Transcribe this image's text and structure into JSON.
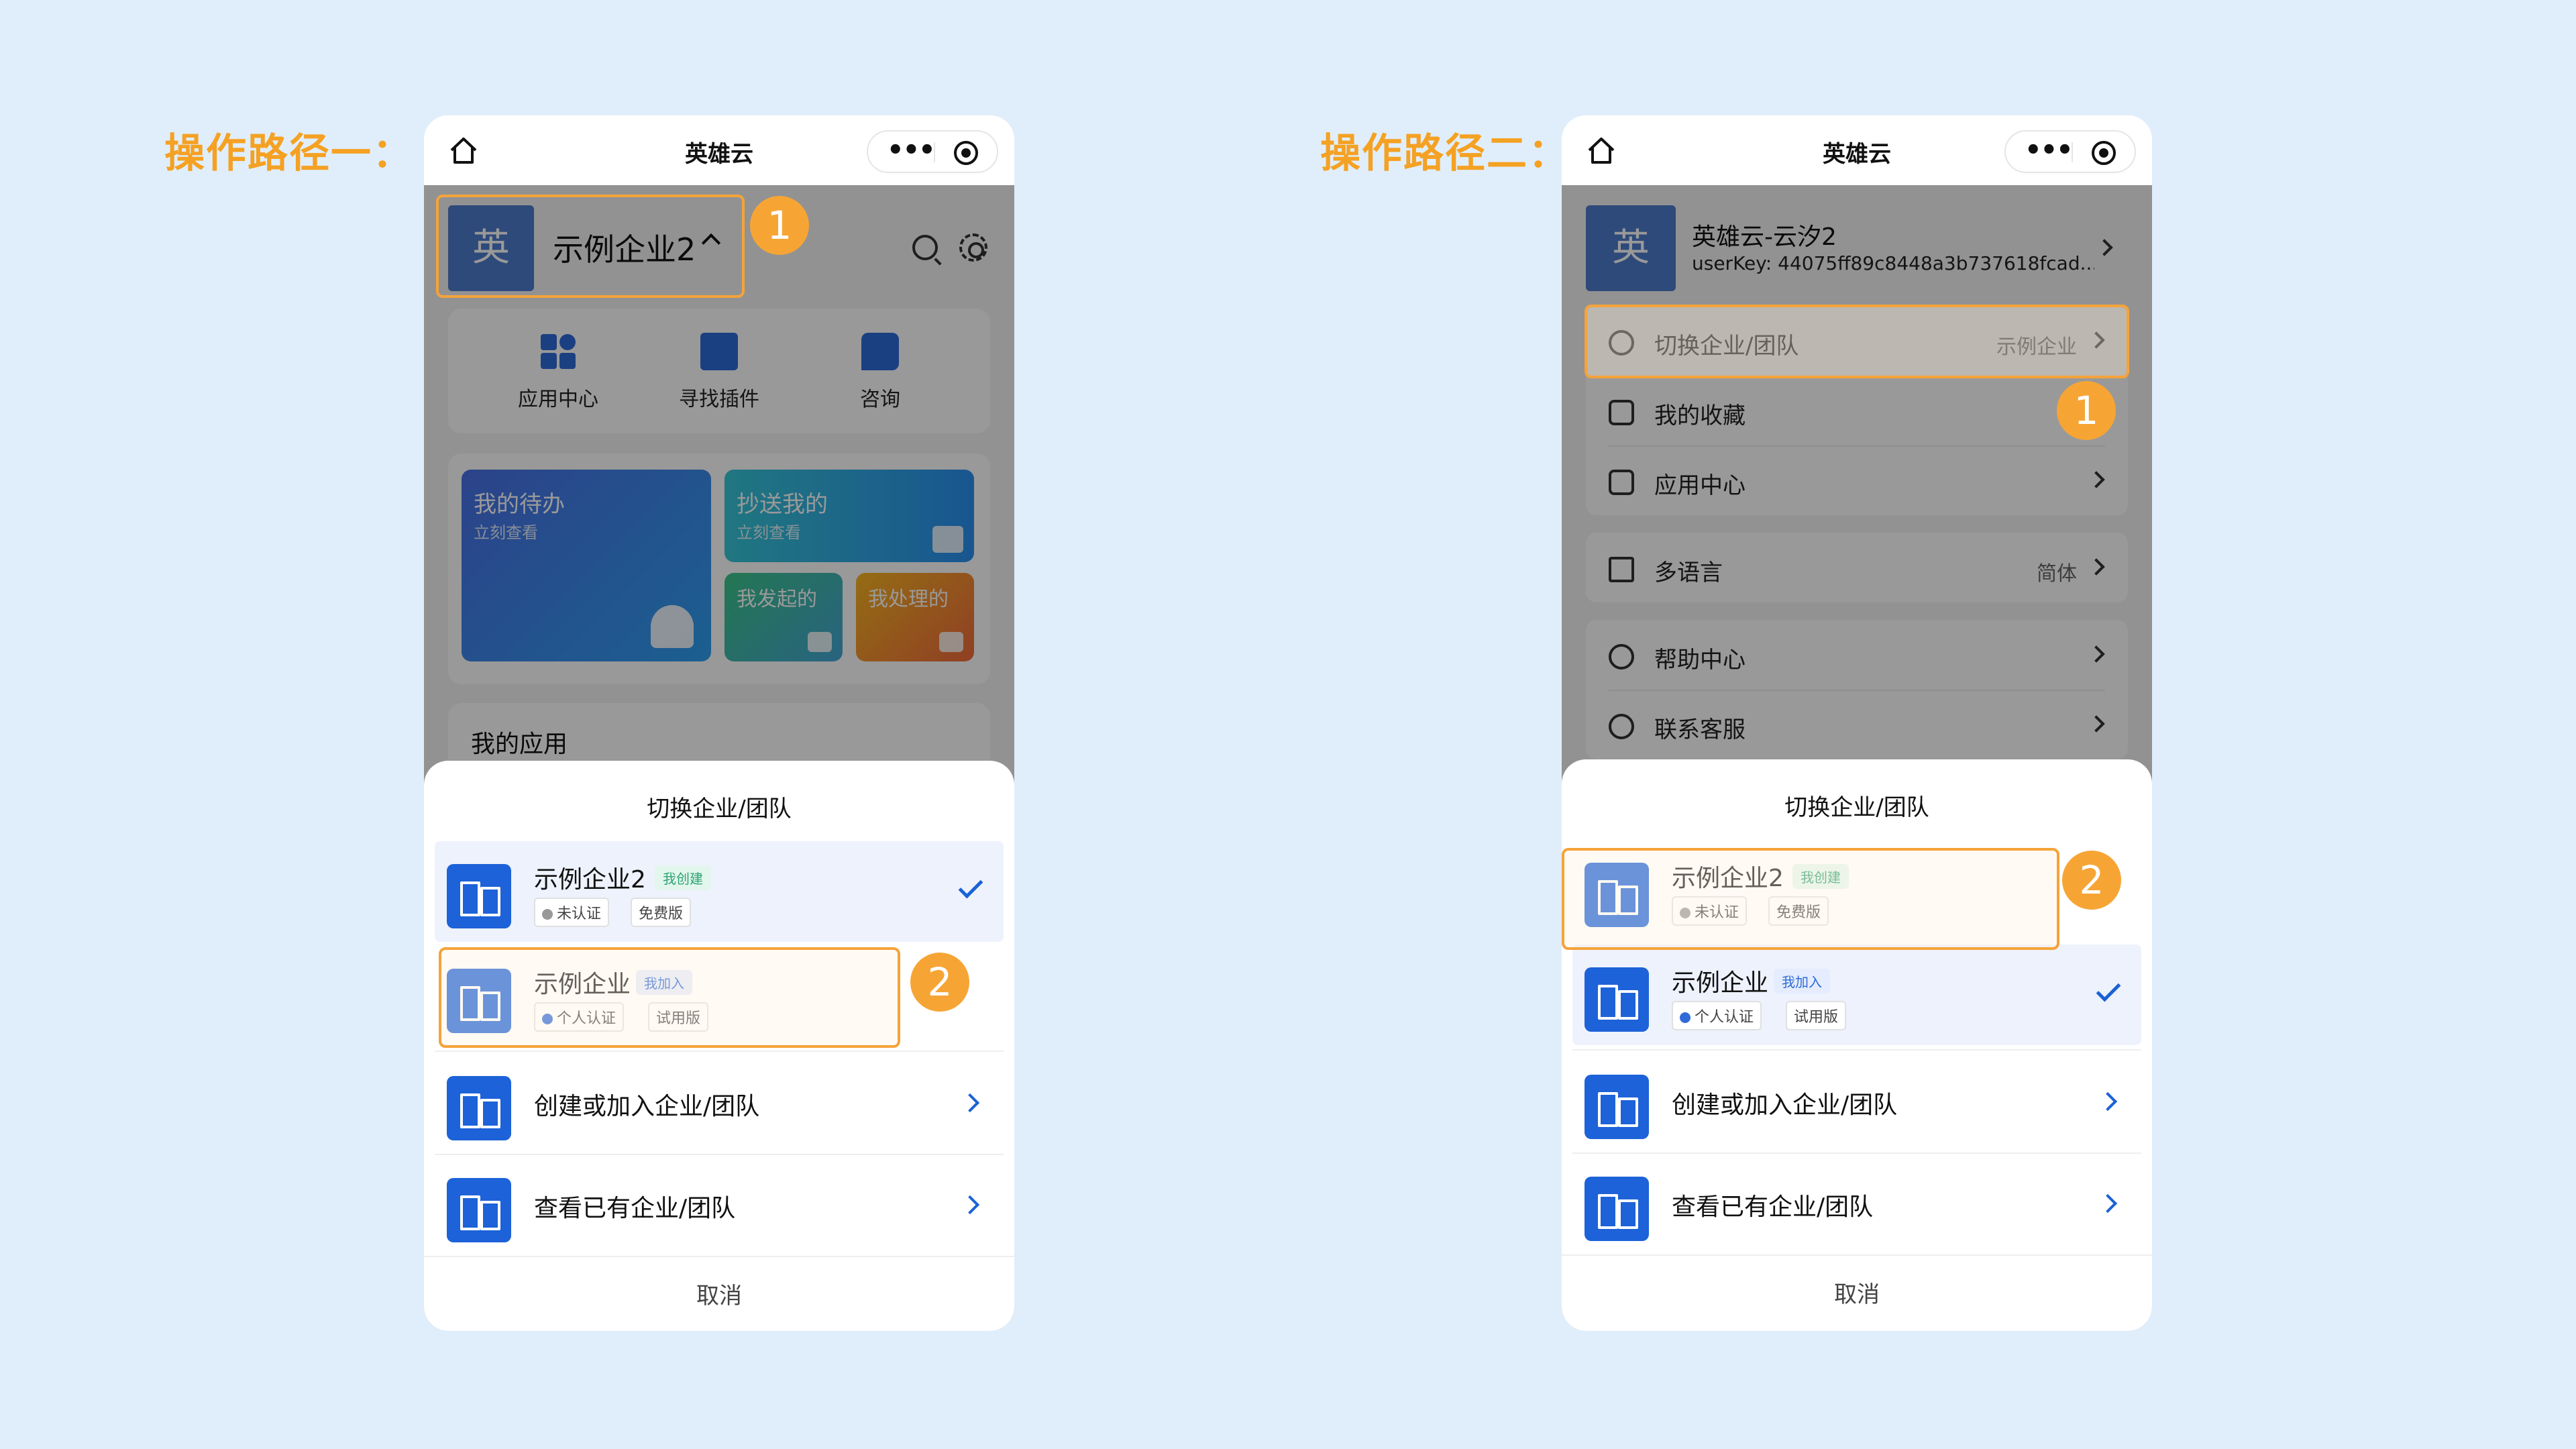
{
  "path1_title": "操作路径一：",
  "path2_title": "操作路径二：",
  "app_title": "英雄云",
  "avatar_char": "英",
  "nav": {
    "more_icon": "more-dots-icon",
    "target_icon": "target-icon",
    "home_icon": "home-icon"
  },
  "phone1": {
    "org_name": "示例企业2",
    "quick": [
      {
        "label": "应用中心",
        "icon": "app-grid-icon"
      },
      {
        "label": "寻找插件",
        "icon": "plugin-box-icon"
      },
      {
        "label": "咨询",
        "icon": "consult-chat-icon"
      }
    ],
    "tiles": {
      "todo": {
        "title": "我的待办",
        "sub": "立刻查看"
      },
      "cc": {
        "title": "抄送我的",
        "sub": "立刻查看"
      },
      "initiated": {
        "title": "我发起的"
      },
      "handled": {
        "title": "我处理的"
      }
    },
    "my_apps": "我的应用"
  },
  "phone2": {
    "user_name": "英雄云-云汐2",
    "user_key": "userKey: 44075ff89c8448a3b737618fcad...",
    "menu": [
      {
        "label": "切换企业/团队",
        "value": "示例企业",
        "icon": "switch-user-icon"
      },
      {
        "label": "我的收藏",
        "value": "",
        "icon": "star-icon"
      },
      {
        "label": "应用中心",
        "value": "",
        "icon": "app-center-icon"
      },
      {
        "label": "多语言",
        "value": "简体",
        "icon": "language-icon"
      },
      {
        "label": "帮助中心",
        "value": "",
        "icon": "help-icon"
      },
      {
        "label": "联系客服",
        "value": "",
        "icon": "headset-icon"
      }
    ]
  },
  "sheet": {
    "title": "切换企业/团队",
    "orgs": [
      {
        "name": "示例企业2",
        "role": "我创建",
        "cert": "未认证",
        "plan": "免费版"
      },
      {
        "name": "示例企业",
        "role": "我加入",
        "cert": "个人认证",
        "plan": "试用版"
      }
    ],
    "actions": [
      {
        "label": "创建或加入企业/团队"
      },
      {
        "label": "查看已有企业/团队"
      }
    ],
    "cancel": "取消"
  },
  "badges": {
    "one": "1",
    "two": "2"
  },
  "colors": {
    "accent_orange": "#f5a123",
    "brand_blue": "#1d62d8",
    "background": "#e0eefb"
  }
}
